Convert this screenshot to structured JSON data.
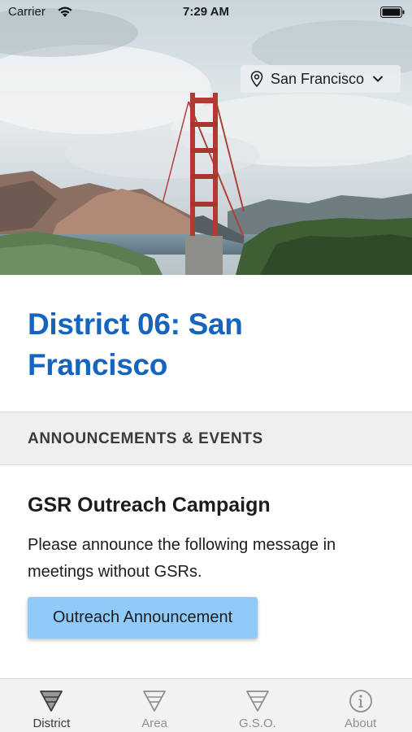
{
  "status_bar": {
    "carrier": "Carrier",
    "time": "7:29 AM"
  },
  "hero": {
    "location": "San Francisco"
  },
  "page": {
    "title": "District 06: San Francisco"
  },
  "section": {
    "header": "ANNOUNCEMENTS & EVENTS"
  },
  "announcement": {
    "title": "GSR Outreach Campaign",
    "body": "Please announce the following message in meetings without GSRs.",
    "button_label": "Outreach Announcement"
  },
  "tab_bar": {
    "tabs": [
      {
        "label": "District",
        "icon": "triangle-stripes-icon",
        "active": true
      },
      {
        "label": "Area",
        "icon": "triangle-stripes-icon",
        "active": false
      },
      {
        "label": "G.S.O.",
        "icon": "triangle-stripes-icon",
        "active": false
      },
      {
        "label": "About",
        "icon": "info-circle-icon",
        "active": false
      }
    ]
  },
  "colors": {
    "title_blue": "#1565c0",
    "button_bg": "#90caf9",
    "section_bg": "#efefef"
  }
}
